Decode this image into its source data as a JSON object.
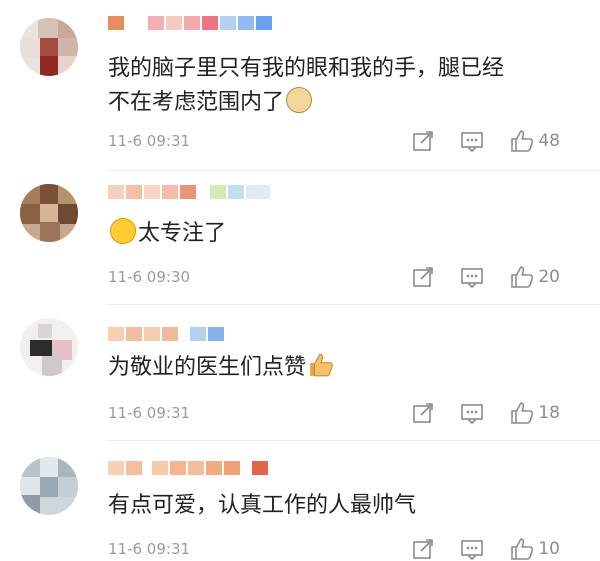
{
  "comments": [
    {
      "text_line1": "我的脑子里只有我的眼和我的手，腿已经",
      "text_line2": "不在考虑范围内了",
      "time": "11-6 09:31",
      "likes": "48",
      "emoji": "cat-face-icon"
    },
    {
      "text": "太专注了",
      "time": "11-6 09:30",
      "likes": "20",
      "emoji": "laughing-tears-icon"
    },
    {
      "text": "为敬业的医生们点赞",
      "time": "11-6 09:31",
      "likes": "18",
      "emoji": "thumbs-up-icon"
    },
    {
      "text": "有点可爱，认真工作的人最帅气",
      "time": "11-6 09:31",
      "likes": "10"
    }
  ],
  "icons": {
    "share": "share-icon",
    "reply": "reply-icon",
    "like": "thumbs-up-icon"
  },
  "colors": {
    "meta_gray": "#9a9a9a",
    "text": "#222222"
  }
}
